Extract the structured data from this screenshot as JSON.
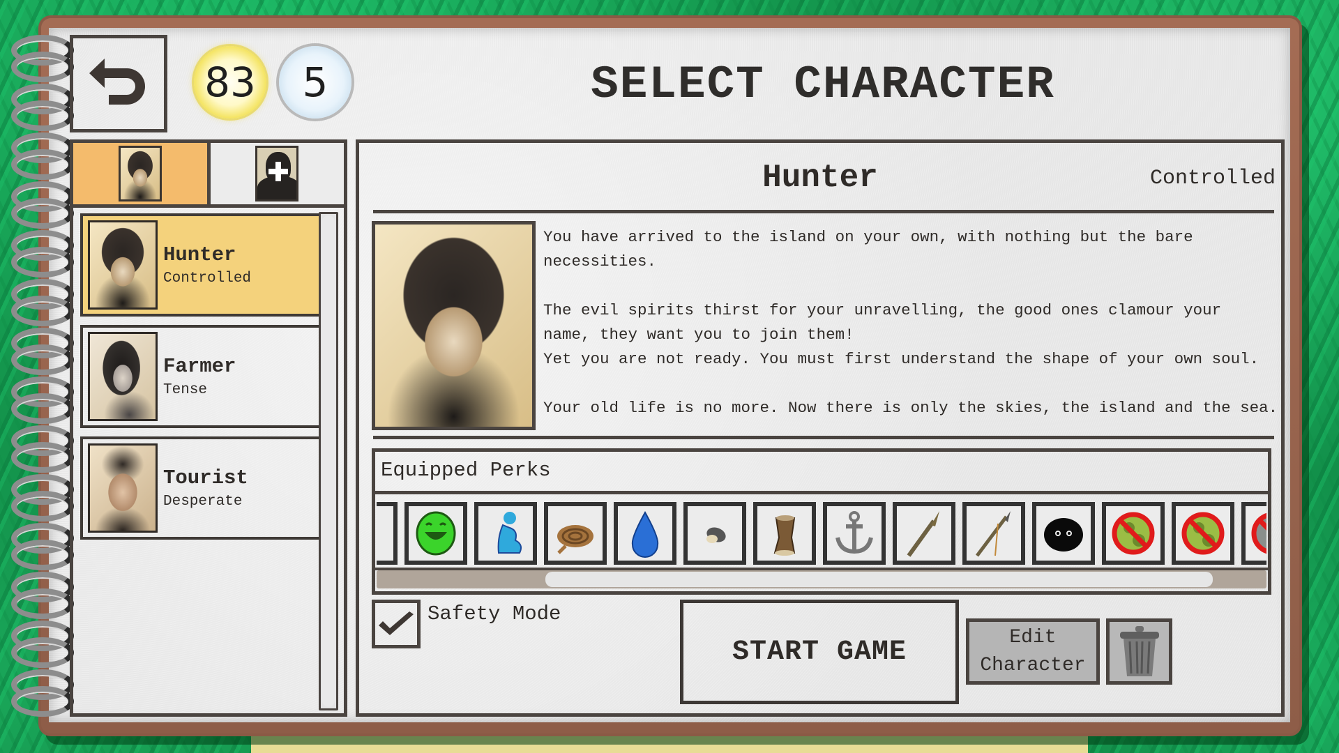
{
  "header": {
    "title": "SELECT CHARACTER",
    "back_icon": "undo-arrow-icon",
    "sun_currency": "83",
    "moon_currency": "5"
  },
  "tabs": [
    {
      "name": "Hunter tab",
      "icon": "portrait-thumbnail",
      "active": true
    },
    {
      "name": "New character tab",
      "icon": "add-character-icon",
      "active": false
    }
  ],
  "characters": [
    {
      "name": "Hunter",
      "state": "Controlled",
      "selected": true
    },
    {
      "name": "Farmer",
      "state": "Tense",
      "selected": false
    },
    {
      "name": "Tourist",
      "state": "Desperate",
      "selected": false
    }
  ],
  "selected": {
    "name": "Hunter",
    "state": "Controlled",
    "description": "You have arrived to the island on your own, with nothing but the bare\nnecessities.\n\nThe evil spirits thirst for your unravelling, the good ones clamour your\nname, they want you to join them!\nYet you are not ready. You must first understand the shape of your own soul.\n\nYour old life is no more. Now there is only the skies, the island and the sea."
  },
  "perks": {
    "title": "Equipped Perks",
    "items": [
      {
        "icon": "face-partial-icon"
      },
      {
        "icon": "happy-face-icon"
      },
      {
        "icon": "sitting-figure-icon"
      },
      {
        "icon": "rope-coil-icon"
      },
      {
        "icon": "water-drop-icon"
      },
      {
        "icon": "stone-icon"
      },
      {
        "icon": "drum-icon"
      },
      {
        "icon": "anchor-icon"
      },
      {
        "icon": "torch-stick-icon"
      },
      {
        "icon": "spear-icon"
      },
      {
        "icon": "shadow-creature-icon"
      },
      {
        "icon": "no-sickness-icon"
      },
      {
        "icon": "no-sickness-icon"
      },
      {
        "icon": "no-fish-icon"
      }
    ],
    "scroll_position": 0.25
  },
  "safety_mode": {
    "label": "Safety Mode",
    "checked": true
  },
  "buttons": {
    "start": "START GAME",
    "edit_line1": "Edit",
    "edit_line2": "Character",
    "delete_icon": "trash-can-icon"
  },
  "colors": {
    "selected_card": "#f4d27c",
    "active_tab": "#f4bb6c",
    "ink": "#2f2b28",
    "frame": "#8a5a45"
  }
}
